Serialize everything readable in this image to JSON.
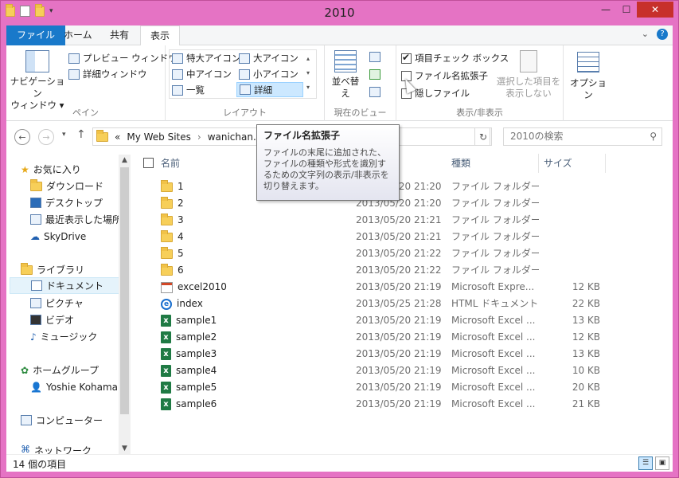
{
  "window": {
    "title": "2010",
    "accent": "#e573c4"
  },
  "menubar": {
    "tabs": [
      {
        "label": "ファイル"
      },
      {
        "label": "ホーム"
      },
      {
        "label": "共有"
      },
      {
        "label": "表示"
      }
    ]
  },
  "ribbon": {
    "pane_group": {
      "navigation_pane": "ナビゲーション\nウィンドウ ▾",
      "preview_pane": "プレビュー ウィンドウ",
      "details_pane": "詳細ウィンドウ",
      "label": "ペイン"
    },
    "layout_group": {
      "items": [
        "特大アイコン",
        "大アイコン",
        "中アイコン",
        "小アイコン",
        "一覧",
        "詳細"
      ],
      "label": "レイアウト"
    },
    "view_group": {
      "sort_by": "並べ替え",
      "label": "現在のビュー"
    },
    "show_hide_group": {
      "item_checkboxes": "項目チェック ボックス",
      "file_extensions": "ファイル名拡張子",
      "hidden_items": "隠しファイル",
      "hide_selected": "選択した項目を\n表示しない",
      "label": "表示/非表示"
    },
    "options": "オプション"
  },
  "address": {
    "path": [
      "«",
      "My Web Sites",
      "wanichan.c"
    ],
    "search_placeholder": "2010の検索"
  },
  "tooltip": {
    "title": "ファイル名拡張子",
    "body": "ファイルの末尾に追加された、ファイルの種類や形式を識別するための文字列の表示/非表示を切り替えます。"
  },
  "nav": {
    "items": [
      {
        "label": "お気に入り",
        "icon": "star-icon"
      },
      {
        "label": "ダウンロード",
        "icon": "download-icon"
      },
      {
        "label": "デスクトップ",
        "icon": "desktop-icon"
      },
      {
        "label": "最近表示した場所",
        "icon": "recent-icon"
      },
      {
        "label": "SkyDrive",
        "icon": "cloud-icon"
      },
      {
        "label": "ライブラリ",
        "icon": "library-icon"
      },
      {
        "label": "ドキュメント",
        "icon": "document-icon"
      },
      {
        "label": "ピクチャ",
        "icon": "picture-icon"
      },
      {
        "label": "ビデオ",
        "icon": "video-icon"
      },
      {
        "label": "ミュージック",
        "icon": "music-icon"
      },
      {
        "label": "ホームグループ",
        "icon": "homegroup-icon"
      },
      {
        "label": "Yoshie Kohama",
        "icon": "user-icon"
      },
      {
        "label": "コンピューター",
        "icon": "computer-icon"
      },
      {
        "label": "ネットワーク",
        "icon": "network-icon"
      }
    ]
  },
  "list": {
    "columns": [
      "名前",
      "種類",
      "サイズ"
    ],
    "rows": [
      {
        "name": "1",
        "date": "2013/05/20 21:20",
        "type": "ファイル フォルダー",
        "size": "",
        "icon": "folder-icon"
      },
      {
        "name": "2",
        "date": "2013/05/20 21:20",
        "type": "ファイル フォルダー",
        "size": "",
        "icon": "folder-icon"
      },
      {
        "name": "3",
        "date": "2013/05/20 21:21",
        "type": "ファイル フォルダー",
        "size": "",
        "icon": "folder-icon"
      },
      {
        "name": "4",
        "date": "2013/05/20 21:21",
        "type": "ファイル フォルダー",
        "size": "",
        "icon": "folder-icon"
      },
      {
        "name": "5",
        "date": "2013/05/20 21:22",
        "type": "ファイル フォルダー",
        "size": "",
        "icon": "folder-icon"
      },
      {
        "name": "6",
        "date": "2013/05/20 21:22",
        "type": "ファイル フォルダー",
        "size": "",
        "icon": "folder-icon"
      },
      {
        "name": "excel2010",
        "date": "2013/05/20 21:19",
        "type": "Microsoft Expre...",
        "size": "12 KB",
        "icon": "expression-icon"
      },
      {
        "name": "index",
        "date": "2013/05/25 21:28",
        "type": "HTML ドキュメント",
        "size": "22 KB",
        "icon": "html-icon"
      },
      {
        "name": "sample1",
        "date": "2013/05/20 21:19",
        "type": "Microsoft Excel ...",
        "size": "13 KB",
        "icon": "excel-icon"
      },
      {
        "name": "sample2",
        "date": "2013/05/20 21:19",
        "type": "Microsoft Excel ...",
        "size": "12 KB",
        "icon": "excel-icon"
      },
      {
        "name": "sample3",
        "date": "2013/05/20 21:19",
        "type": "Microsoft Excel ...",
        "size": "13 KB",
        "icon": "excel-icon"
      },
      {
        "name": "sample4",
        "date": "2013/05/20 21:19",
        "type": "Microsoft Excel ...",
        "size": "10 KB",
        "icon": "excel-icon"
      },
      {
        "name": "sample5",
        "date": "2013/05/20 21:19",
        "type": "Microsoft Excel ...",
        "size": "20 KB",
        "icon": "excel-icon"
      },
      {
        "name": "sample6",
        "date": "2013/05/20 21:19",
        "type": "Microsoft Excel ...",
        "size": "21 KB",
        "icon": "excel-icon"
      }
    ]
  },
  "status": {
    "count": "14 個の項目"
  }
}
